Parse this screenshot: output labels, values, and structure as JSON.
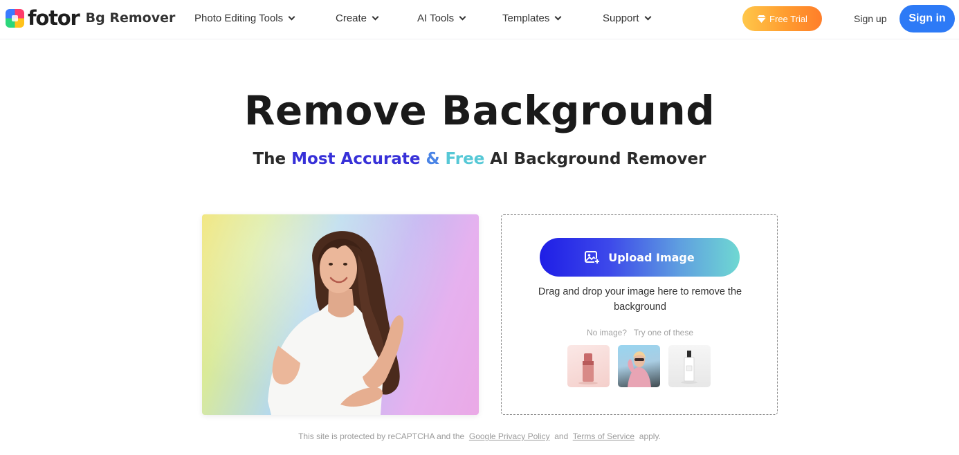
{
  "header": {
    "brand": "fotor",
    "product": "Bg Remover",
    "nav": [
      {
        "label": "Photo Editing Tools"
      },
      {
        "label": "Create"
      },
      {
        "label": "AI Tools"
      },
      {
        "label": "Templates"
      },
      {
        "label": "Support"
      }
    ],
    "free_trial_label": "Free Trial",
    "sign_up_label": "Sign up",
    "sign_in_label": "Sign in"
  },
  "hero": {
    "title": "Remove Background",
    "subtitle": {
      "prefix": "The ",
      "highlight1": "Most Accurate",
      "amp": " & ",
      "highlight2": "Free",
      "suffix": " AI Background Remover"
    }
  },
  "upload": {
    "button_label": "Upload Image",
    "drag_text": "Drag and drop your image here to remove the background",
    "no_image_label": "No image?",
    "try_label": "Try one of these",
    "samples": [
      "lipstick",
      "woman-in-pink-jacket",
      "perfume-bottle"
    ]
  },
  "footer": {
    "recaptcha_prefix": "This site is protected by reCAPTCHA and the",
    "privacy_link": "Google Privacy Policy",
    "and": "and",
    "terms_link": "Terms of Service",
    "apply": "apply."
  },
  "colors": {
    "brand_blue": "#2d7af6",
    "accent_indigo": "#3730d8",
    "accent_cyan": "#56c8d6",
    "trial_orange": "#ff9c2f"
  }
}
